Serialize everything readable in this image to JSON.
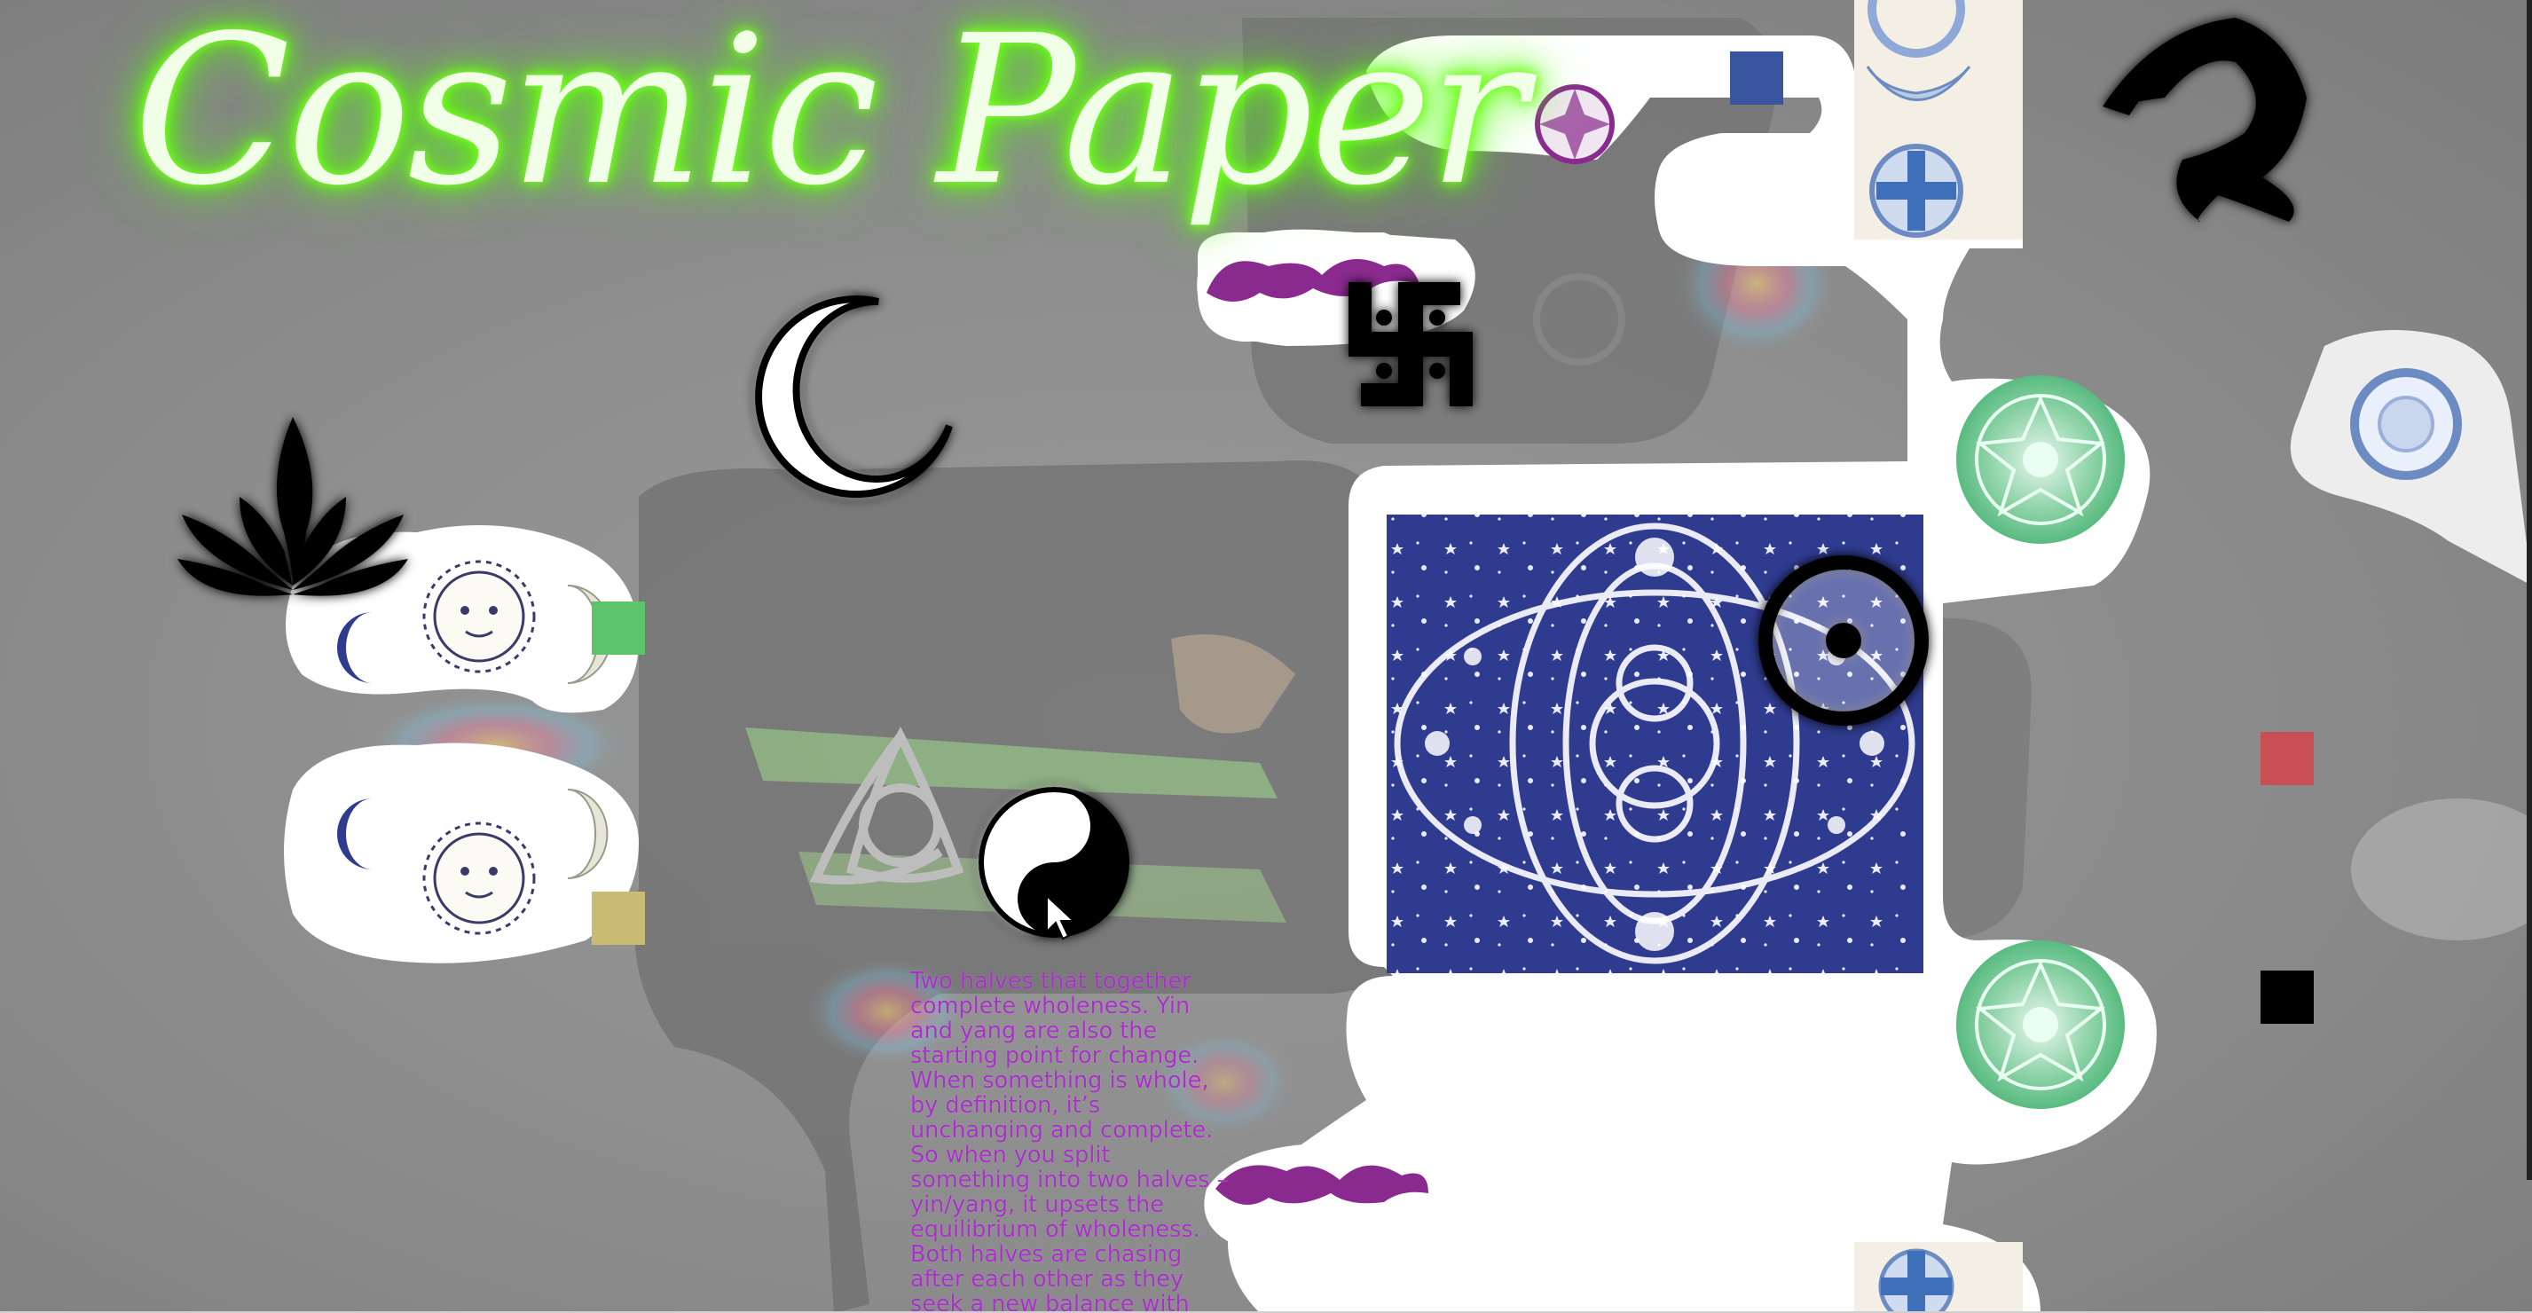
{
  "title": "Cosmic Paper",
  "yin_yang_caption": "Two halves that together complete wholeness. Yin and yang are also the starting point for change. When something is whole, by definition, it’s unchanging and complete. So when you split something into two halves – yin/yang, it upsets the equilibrium of wholeness. Both halves are chasing after each other as they seek a new balance with each other.",
  "colors": {
    "title_glow": "#5aff10",
    "caption": "#a832c8",
    "card_navy": "#2f3b8f",
    "square_blue": "#3a55a0",
    "square_green": "#5cc46a",
    "square_khaki": "#c9bb72",
    "square_red": "#c94f55",
    "square_black": "#000000",
    "square_white": "#ffffff"
  },
  "symbols": [
    "lotus-icon",
    "crescent-moon-icon",
    "swastika-icon",
    "dragon-icon",
    "bullseye-icon",
    "yin-yang-icon",
    "triquetra-icon",
    "sun-face-icon",
    "mandala-icon",
    "pointer-cursor-icon"
  ]
}
